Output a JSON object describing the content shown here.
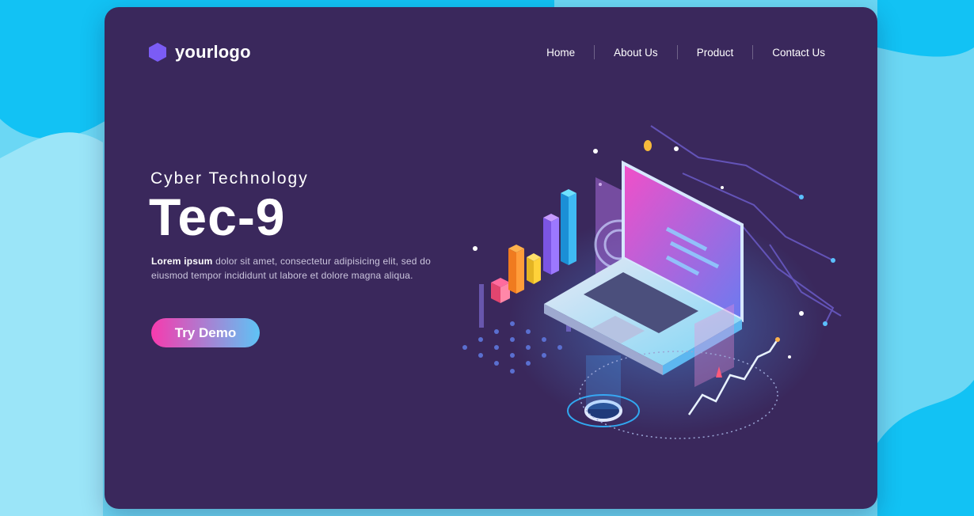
{
  "logo": {
    "text": "yourlogo",
    "icon": "hexagon-icon",
    "color": "#7b5cf5"
  },
  "nav": {
    "items": [
      {
        "label": "Home"
      },
      {
        "label": "About Us"
      },
      {
        "label": "Product"
      },
      {
        "label": "Contact Us"
      }
    ]
  },
  "hero": {
    "subtitle": "Cyber Technology",
    "title": "Tec-9",
    "desc_bold": "Lorem ipsum",
    "desc_rest": " dolor sit amet, consectetur adipisicing elit, sed do eiusmod tempor incididunt ut labore et dolore magna aliqua.",
    "cta_label": "Try Demo"
  },
  "colors": {
    "background": "#6ad6f3",
    "card": "#3a285c",
    "accent_pink": "#f73aae",
    "accent_blue": "#5ec3f5"
  },
  "illustration": {
    "icon": "isometric-laptop-illustration"
  }
}
